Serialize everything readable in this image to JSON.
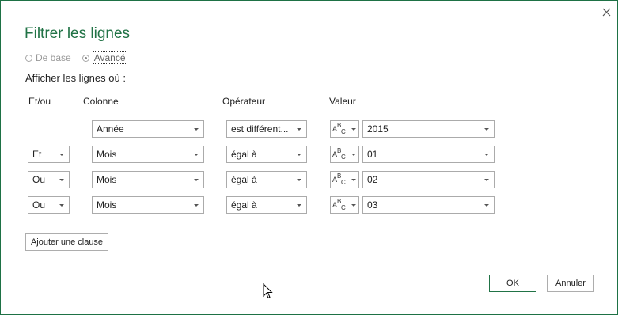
{
  "dialog": {
    "title": "Filtrer les lignes",
    "mode_basic": "De base",
    "mode_advanced": "Avancé",
    "subtitle": "Afficher les lignes où :"
  },
  "columns": {
    "andor": "Et/ou",
    "column": "Colonne",
    "operator": "Opérateur",
    "value": "Valeur"
  },
  "clauses": [
    {
      "andor": "",
      "column": "Année",
      "operator": "est différent...",
      "value_type": "ABC",
      "value": "2015"
    },
    {
      "andor": "Et",
      "column": "Mois",
      "operator": "égal à",
      "value_type": "ABC",
      "value": "01"
    },
    {
      "andor": "Ou",
      "column": "Mois",
      "operator": "égal à",
      "value_type": "ABC",
      "value": "02"
    },
    {
      "andor": "Ou",
      "column": "Mois",
      "operator": "égal à",
      "value_type": "ABC",
      "value": "03"
    }
  ],
  "buttons": {
    "add_clause": "Ajouter une clause",
    "ok": "OK",
    "cancel": "Annuler"
  },
  "colors": {
    "accent": "#217346",
    "border": "#1e7145"
  }
}
